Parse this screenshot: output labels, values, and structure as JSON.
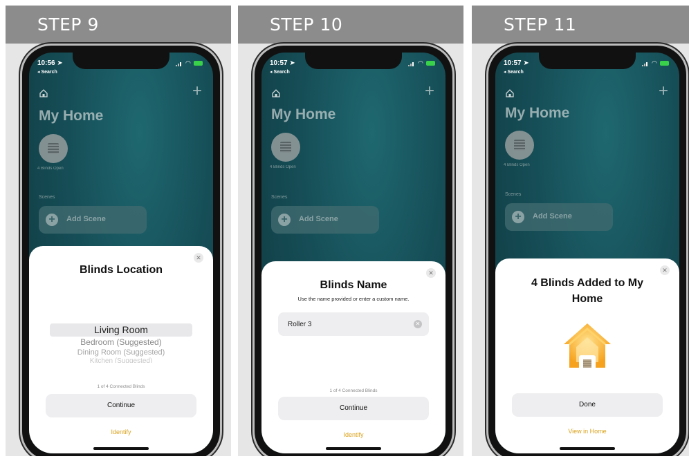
{
  "steps": [
    {
      "label": "STEP 9",
      "time": "10:56",
      "search": "◂ Search",
      "title": "My Home",
      "accessory_label": "4 Blinds Open",
      "scenes_label": "Scenes",
      "add_scene": "Add Scene",
      "sheet": {
        "title": "Blinds Location",
        "picker": [
          "Living Room",
          "Bedroom (Suggested)",
          "Dining Room (Suggested)",
          "Kitchen (Suggested)"
        ],
        "selected": "Living Room",
        "counter": "1 of 4 Connected Blinds",
        "primary_button": "Continue",
        "link": "Identify"
      }
    },
    {
      "label": "STEP 10",
      "time": "10:57",
      "search": "◂ Search",
      "title": "My Home",
      "accessory_label": "4 Blinds Open",
      "scenes_label": "Scenes",
      "add_scene": "Add Scene",
      "sheet": {
        "title": "Blinds Name",
        "subtitle": "Use the name provided or enter a custom name.",
        "field_value": "Roller 3",
        "counter": "1 of 4 Connected Blinds",
        "primary_button": "Continue",
        "link": "Identify"
      }
    },
    {
      "label": "STEP 11",
      "time": "10:57",
      "search": "◂ Search",
      "title": "My Home",
      "accessory_label": "4 Blinds Open",
      "scenes_label": "Scenes",
      "add_scene": "Add Scene",
      "sheet": {
        "title": "4 Blinds Added to My Home",
        "primary_button": "Done",
        "link": "View in Home"
      }
    }
  ],
  "colors": {
    "accent": "#d9a21b",
    "banner": "#8c8c8c",
    "home_bg": "#164e57"
  },
  "icons": [
    "location-arrow-icon",
    "signal-icon",
    "wifi-icon",
    "battery-icon",
    "home-icon",
    "plus-icon",
    "blinds-icon",
    "add-icon",
    "close-icon",
    "clear-icon",
    "home-app-icon"
  ]
}
